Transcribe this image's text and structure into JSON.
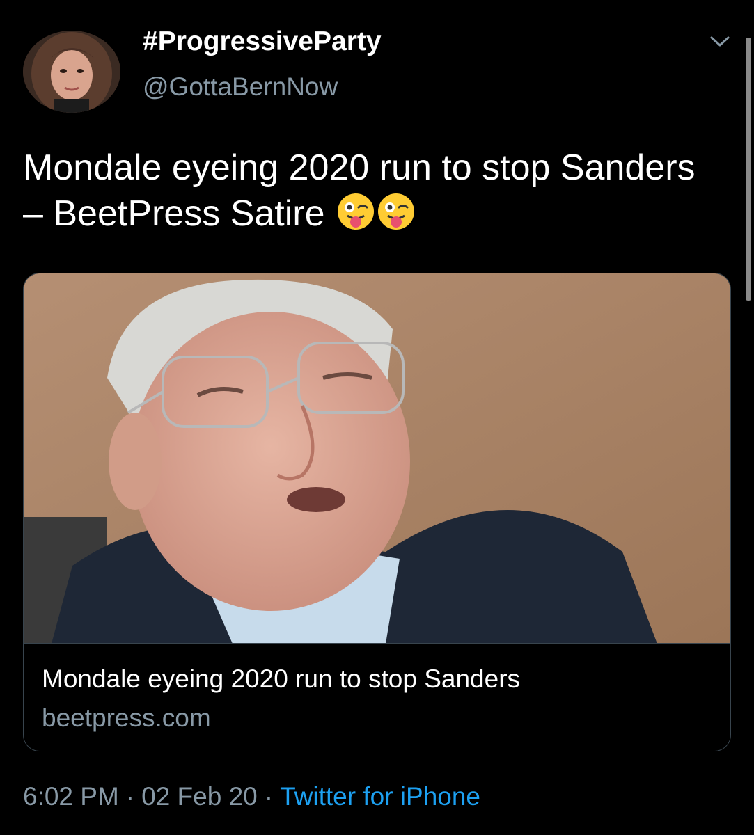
{
  "tweet": {
    "author": {
      "display_name": "#ProgressiveParty",
      "handle": "@GottaBernNow"
    },
    "text": "Mondale eyeing 2020 run to stop Sanders – BeetPress Satire",
    "emojis": [
      "winking-face-with-tongue-emoji",
      "winking-face-with-tongue-emoji"
    ],
    "card": {
      "title": "Mondale eyeing 2020 run to stop Sanders",
      "domain": "beetpress.com"
    },
    "meta": {
      "time": "6:02 PM",
      "separator": "·",
      "date": "02 Feb 20",
      "source": "Twitter for iPhone"
    }
  },
  "colors": {
    "background": "#000000",
    "primary_text": "#ffffff",
    "secondary_text": "#8899a6",
    "link": "#1da1f2",
    "border": "#38444d"
  }
}
